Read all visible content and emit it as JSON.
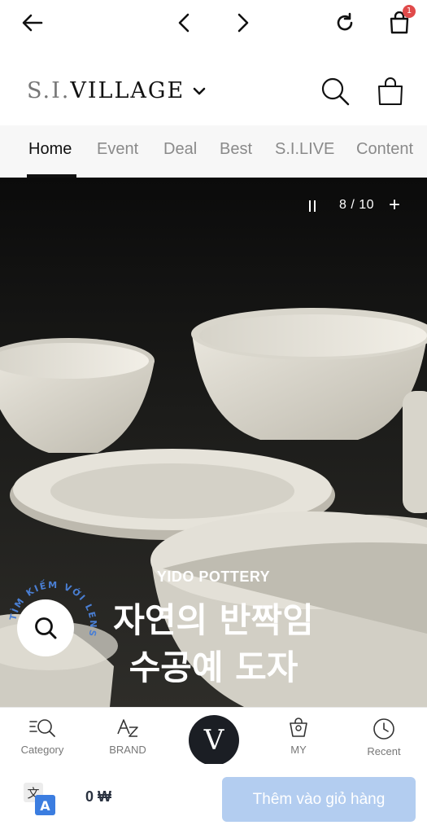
{
  "browser": {
    "cart_badge": "1"
  },
  "header": {
    "logo_light": "S.I.",
    "logo_dark": "VILLAGE"
  },
  "tabs": [
    {
      "label": "Home",
      "active": true
    },
    {
      "label": "Event"
    },
    {
      "label": "Deal"
    },
    {
      "label": "Best"
    },
    {
      "label": "S.I.LIVE"
    },
    {
      "label": "Content"
    }
  ],
  "hero": {
    "counter": "8 / 10",
    "subtitle": "YIDO POTTERY",
    "title_line1": "자연의 반짝임",
    "title_line2": "수공예 도자",
    "search_ring_text": "TÌM KIẾM VỚI LENS"
  },
  "bottom_nav": {
    "category": "Category",
    "brand": "BRAND",
    "center": "V",
    "my": "MY",
    "recent": "Recent"
  },
  "cart": {
    "price": "0 ₩",
    "add_to_cart": "Thêm vào giỏ hàng"
  },
  "colors": {
    "add_to_cart_bg": "#b3cdf0",
    "badge": "#e04a4a",
    "v_button": "#1b1e24"
  }
}
